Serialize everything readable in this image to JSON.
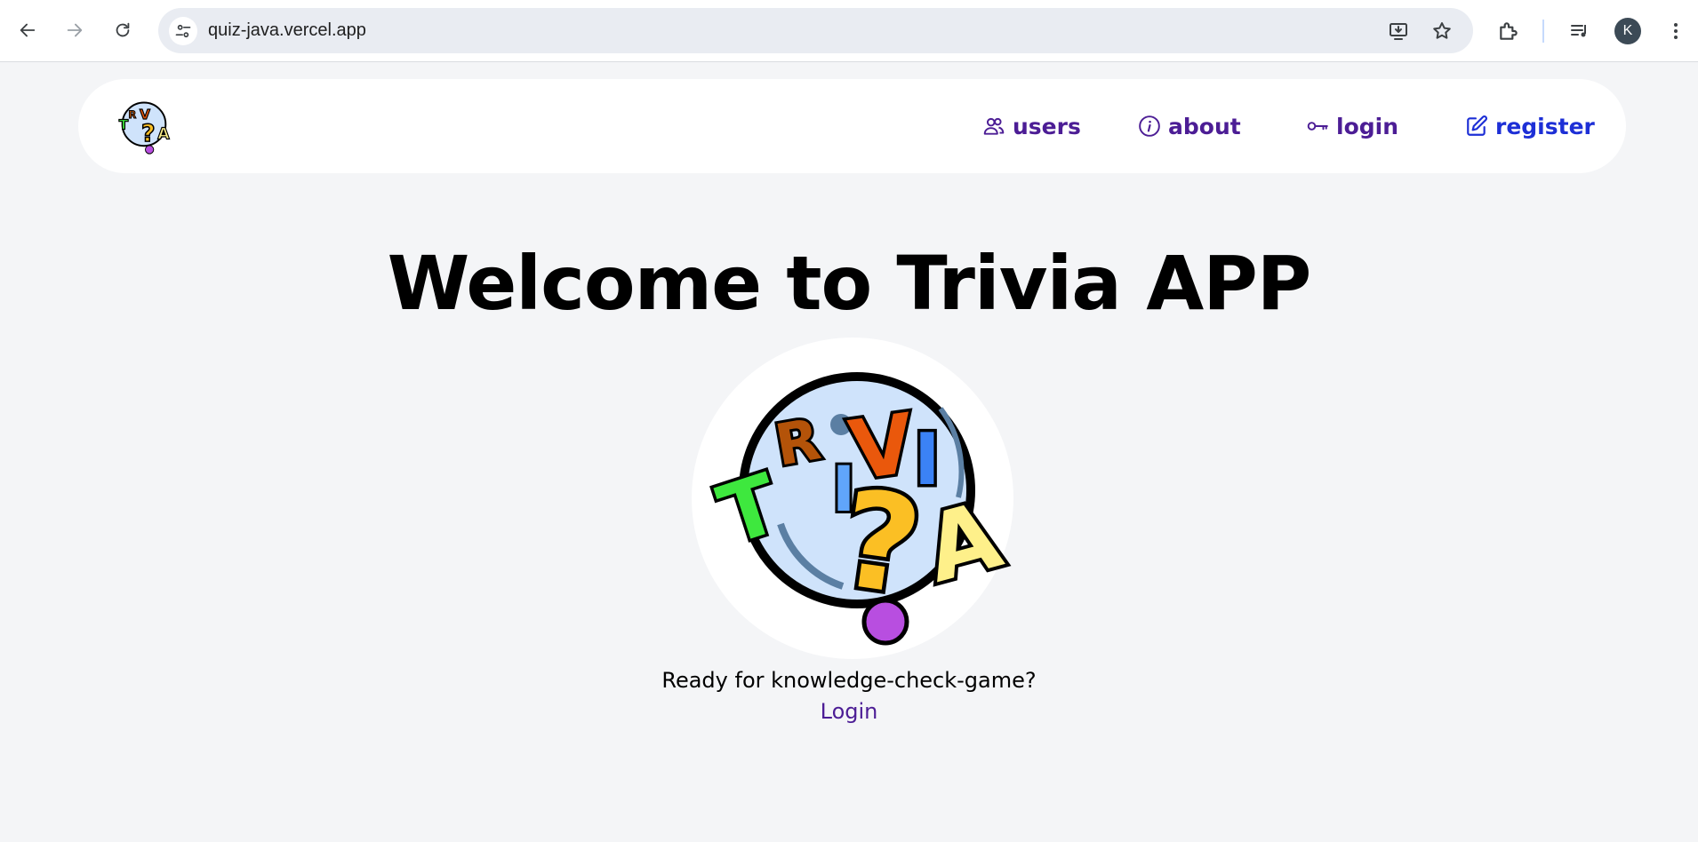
{
  "browser": {
    "url": "quiz-java.vercel.app",
    "profile_initial": "K",
    "icons": {
      "back": "back-arrow-icon",
      "forward": "forward-arrow-icon",
      "reload": "reload-icon",
      "site_info": "tune-icon",
      "install": "install-app-icon",
      "bookmark": "star-icon",
      "extensions": "puzzle-icon",
      "media": "media-control-icon",
      "menu": "kebab-menu-icon"
    }
  },
  "nav": {
    "logo_text": "TRIVIA",
    "items": [
      {
        "label": "users",
        "icon": "users-icon"
      },
      {
        "label": "about",
        "icon": "info-icon"
      },
      {
        "label": "login",
        "icon": "key-icon"
      },
      {
        "label": "register",
        "icon": "edit-icon"
      }
    ]
  },
  "main": {
    "title": "Welcome to Trivia APP",
    "hero_logo_text": "TRIVIA",
    "tagline": "Ready for knowledge-check-game?",
    "login_label": "Login"
  },
  "colors": {
    "page_bg": "#f4f5f7",
    "nav_link": "#4c1d95",
    "register_link": "#1d2fd6",
    "question_mark": "#fbbf24",
    "dot": "#b84ee0"
  }
}
